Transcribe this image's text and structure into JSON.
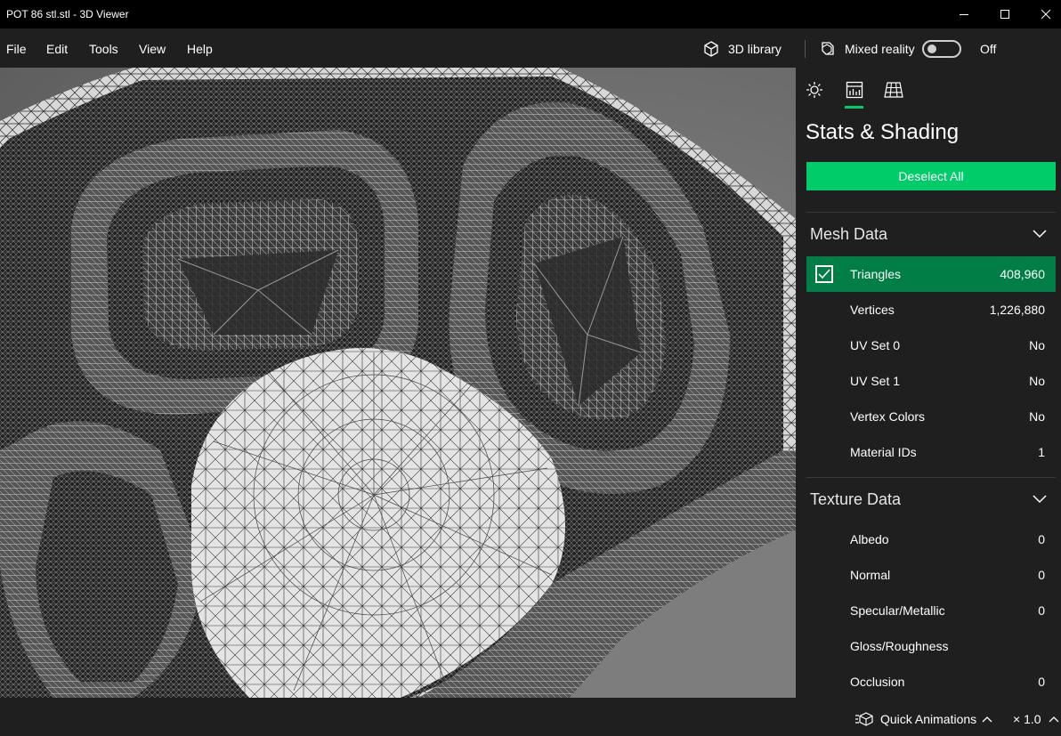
{
  "window": {
    "title": "POT 86 stl.stl - 3D Viewer"
  },
  "menu": {
    "items": [
      "File",
      "Edit",
      "Tools",
      "View",
      "Help"
    ]
  },
  "toolbar": {
    "library_label": "3D library",
    "mixed_reality_label": "Mixed reality",
    "toggle_state": "Off"
  },
  "panel": {
    "title": "Stats & Shading",
    "deselect_label": "Deselect All",
    "mesh": {
      "heading": "Mesh Data",
      "rows": [
        {
          "label": "Triangles",
          "value": "408,960",
          "selected": true
        },
        {
          "label": "Vertices",
          "value": "1,226,880"
        },
        {
          "label": "UV Set 0",
          "value": "No"
        },
        {
          "label": "UV Set 1",
          "value": "No"
        },
        {
          "label": "Vertex Colors",
          "value": "No"
        },
        {
          "label": "Material IDs",
          "value": "1"
        }
      ]
    },
    "texture": {
      "heading": "Texture Data",
      "rows": [
        {
          "label": "Albedo",
          "value": "0"
        },
        {
          "label": "Normal",
          "value": "0"
        },
        {
          "label": "Specular/Metallic",
          "value": "0"
        },
        {
          "label": "Gloss/Roughness",
          "value": ""
        },
        {
          "label": "Occlusion",
          "value": "0"
        }
      ]
    }
  },
  "status": {
    "animations_label": "Quick Animations",
    "speed_label": "× 1.0"
  },
  "colors": {
    "accent": "#00cc6a",
    "selected_row": "#007e45",
    "background": "#1f1f1f",
    "titlebar": "#000000"
  }
}
